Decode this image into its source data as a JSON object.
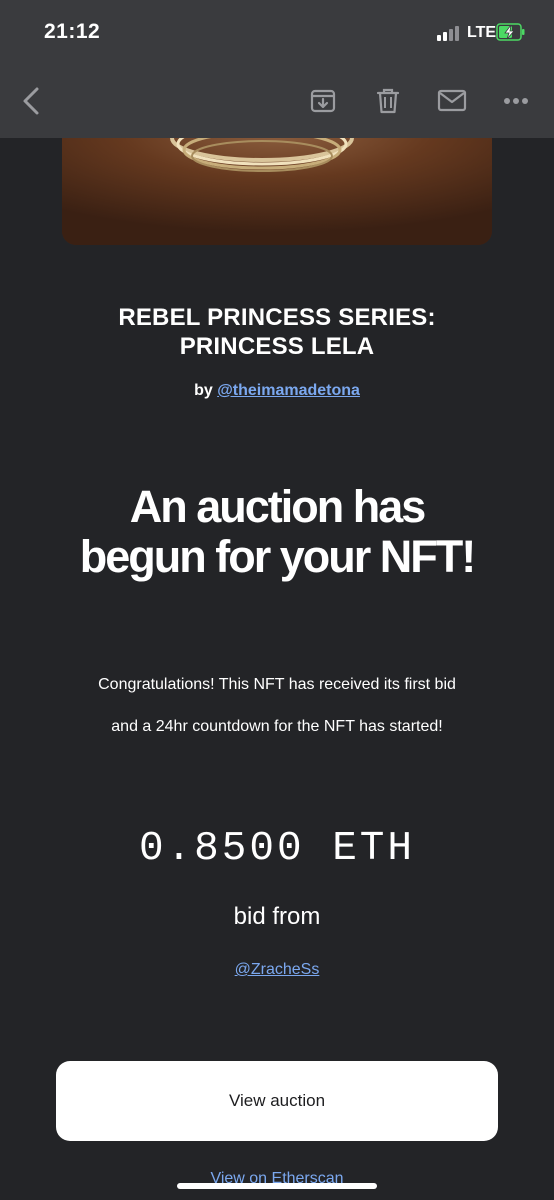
{
  "status_bar": {
    "time": "21:12",
    "network": "LTE"
  },
  "toolbar": {
    "back_icon": "chevron-left-icon",
    "archive_icon": "archive-icon",
    "trash_icon": "trash-icon",
    "mail_icon": "mail-icon",
    "more_icon": "more-icon"
  },
  "nft": {
    "series_title_line1": "REBEL PRINCESS SERIES:",
    "series_title_line2": "PRINCESS LELA",
    "by_label": "by",
    "creator": "@theimamadetona"
  },
  "headline": {
    "line1": "An auction has",
    "line2": "begun for your NFT!"
  },
  "message": {
    "line1": "Congratulations! This NFT has received its first bid",
    "line2": "and a 24hr countdown for the NFT has started!"
  },
  "bid": {
    "amount": "0.8500 ETH",
    "from_label": "bid from",
    "bidder": "@ZracheSs"
  },
  "actions": {
    "view_auction": "View auction",
    "view_etherscan": "View on Etherscan"
  },
  "colors": {
    "background": "#232427",
    "toolbar": "#3a3b3e",
    "link": "#7ba8ef",
    "button": "#ffffff",
    "battery": "#4cd964"
  }
}
